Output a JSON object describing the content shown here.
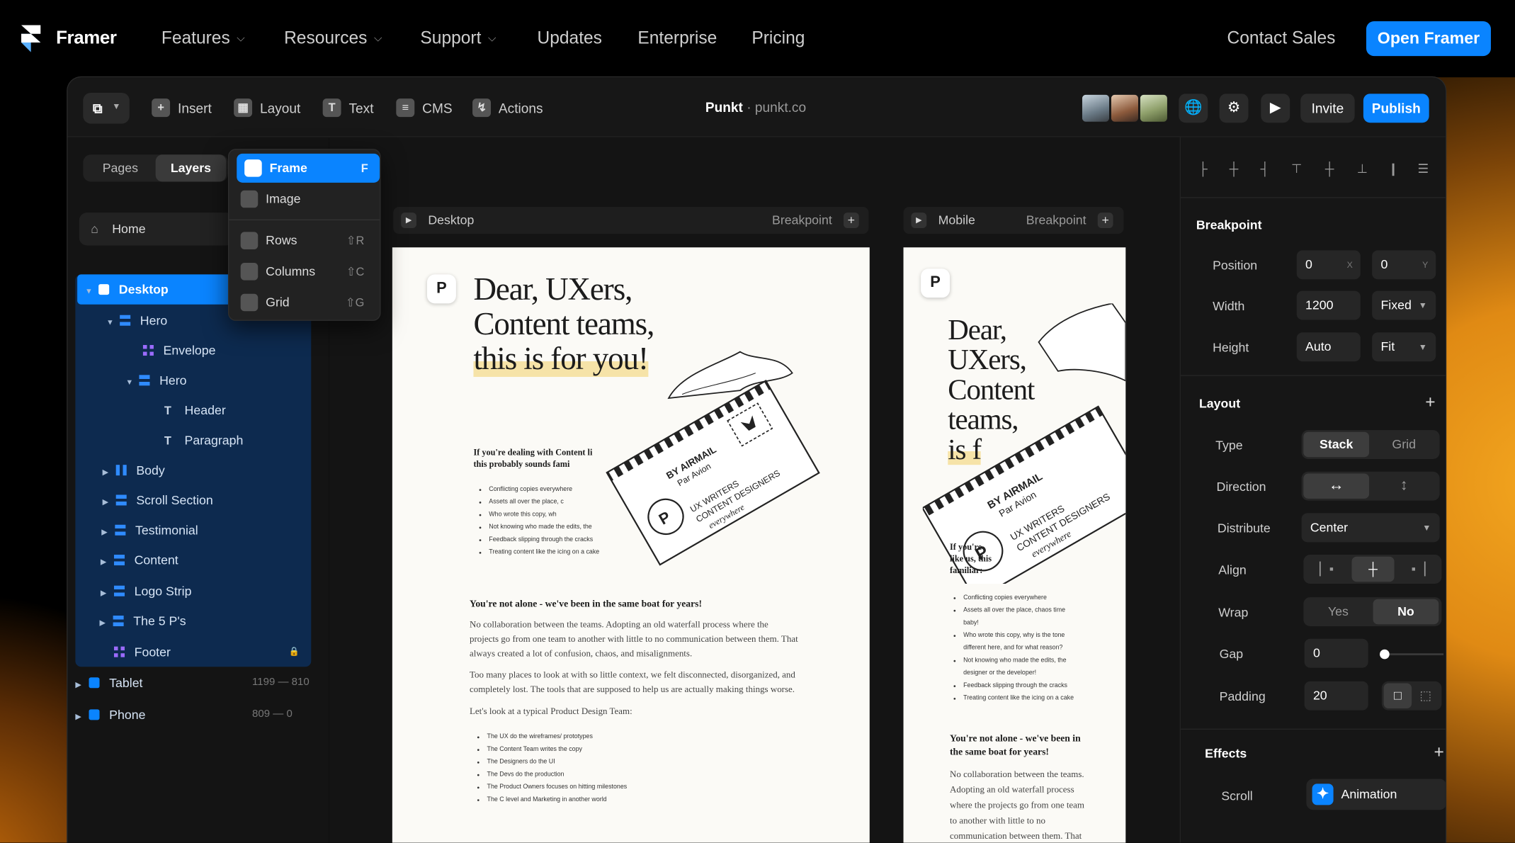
{
  "site_nav": {
    "brand": "Framer",
    "items": [
      {
        "label": "Features",
        "has_menu": true
      },
      {
        "label": "Resources",
        "has_menu": true
      },
      {
        "label": "Support",
        "has_menu": true
      },
      {
        "label": "Updates",
        "has_menu": false
      },
      {
        "label": "Enterprise",
        "has_menu": false
      },
      {
        "label": "Pricing",
        "has_menu": false
      }
    ],
    "contact": "Contact Sales",
    "cta": "Open Framer"
  },
  "toolbar": {
    "insert": "Insert",
    "layout": "Layout",
    "text": "Text",
    "cms": "CMS",
    "actions": "Actions",
    "project_name": "Punkt",
    "separator": "·",
    "project_domain": "punkt.co",
    "invite": "Invite",
    "publish": "Publish"
  },
  "left_panel": {
    "tabs": [
      "Pages",
      "Layers"
    ],
    "active_tab": "Layers",
    "home": "Home",
    "layers": {
      "desktop": "Desktop",
      "hero": "Hero",
      "envelope": "Envelope",
      "hero_inner": "Hero",
      "header": "Header",
      "paragraph": "Paragraph",
      "body": "Body",
      "scroll_section": "Scroll Section",
      "testimonial": "Testimonial",
      "content": "Content",
      "logo_strip": "Logo Strip",
      "the5ps": "The 5 P's",
      "footer": "Footer",
      "tablet": "Tablet",
      "tablet_range": "1199 — 810",
      "phone": "Phone",
      "phone_range": "809 — 0"
    }
  },
  "insert_menu": {
    "frame": "Frame",
    "frame_key": "F",
    "image": "Image",
    "rows": "Rows",
    "rows_key": "⇧R",
    "columns": "Columns",
    "columns_key": "⇧C",
    "grid": "Grid",
    "grid_key": "⇧G"
  },
  "canvas": {
    "desktop_label": "Desktop",
    "mobile_label": "Mobile",
    "breakpoint": "Breakpoint",
    "desktop_page": {
      "headline": [
        "Dear, UXers,",
        "Content teams,",
        "this is for you!"
      ],
      "intro": [
        "If you're dealing with Content li",
        "this probably sounds fami"
      ],
      "bullets": [
        "Conflicting copies everywhere",
        "Assets all over the place, c",
        "Who wrote this copy, wh",
        "Not knowing who made the edits, the",
        "Feedback slipping through the cracks",
        "Treating content like the icing on a cake"
      ],
      "subhead": "You're not alone - we've been in the same boat for years!",
      "para1": "No collaboration between the teams. Adopting an old waterfall process where the projects go from one team to another with little to no communication between them. That always created a lot of confusion, chaos, and misalignments.",
      "para2": "Too many places to look at with so little context, we felt disconnected, disorganized, and completely lost. The tools that are supposed to help us are actually making things worse.",
      "para3": "Let's look at a typical Product Design Team:",
      "team": [
        "The UX do the wireframes/ prototypes",
        "The Content Team writes the copy",
        "The Designers do the UI",
        "The Devs do the production",
        "The Product Owners focuses on hitting milestones",
        "The C level and Marketing in another world"
      ]
    },
    "mobile_page": {
      "headline": [
        "Dear,",
        "UXers,",
        "Content",
        "teams,",
        "is f"
      ],
      "intro": [
        "If you're",
        "like us, this",
        "familiar:"
      ],
      "bullets": [
        "Conflicting copies everywhere",
        "Assets all over the place, chaos time baby!",
        "Who wrote this copy, why is the tone different here, and for what reason?",
        "Not knowing who made the edits, the designer or the developer!",
        "Feedback slipping through the cracks",
        "Treating content like the icing on a cake"
      ],
      "subhead": "You're not alone - we've been in the same boat for years!",
      "para": "No collaboration between the teams. Adopting an old waterfall process where the projects go from one team to another with little to no communication between them. That"
    },
    "envelope_stamp": [
      "BY AIRMAIL",
      "Par Avion"
    ],
    "envelope_text": [
      "UX WRITERS",
      "CONTENT DESIGNERS",
      "everywhere"
    ]
  },
  "right_panel": {
    "breakpoint_title": "Breakpoint",
    "position_label": "Position",
    "pos_x": "0",
    "pos_x_hint": "X",
    "pos_y": "0",
    "pos_y_hint": "Y",
    "width_label": "Width",
    "width_value": "1200",
    "width_mode": "Fixed",
    "height_label": "Height",
    "height_value": "Auto",
    "height_mode": "Fit",
    "layout_title": "Layout",
    "type_label": "Type",
    "type_options": [
      "Stack",
      "Grid"
    ],
    "type_selected": "Stack",
    "direction_label": "Direction",
    "distribute_label": "Distribute",
    "distribute_value": "Center",
    "align_label": "Align",
    "wrap_label": "Wrap",
    "wrap_options": [
      "Yes",
      "No"
    ],
    "wrap_selected": "No",
    "gap_label": "Gap",
    "gap_value": "0",
    "padding_label": "Padding",
    "padding_value": "20",
    "effects_title": "Effects",
    "scroll_label": "Scroll",
    "scroll_value": "Animation"
  },
  "colors": {
    "accent": "#0a84ff",
    "background": "#000000",
    "panel": "#161616",
    "selected_tree": "#0d2a4f",
    "glow": "#f3a61f"
  }
}
